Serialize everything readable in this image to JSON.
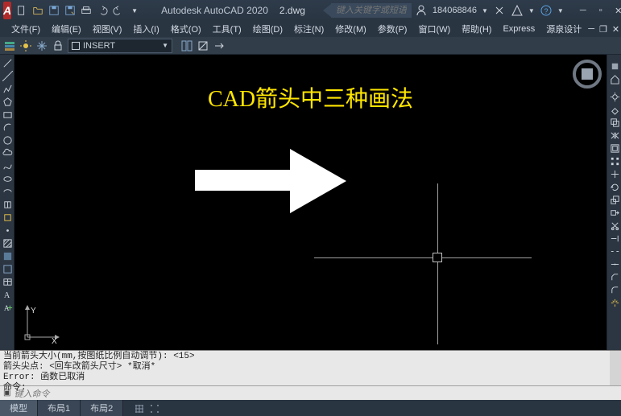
{
  "titlebar": {
    "app_name": "Autodesk AutoCAD 2020",
    "document": "2.dwg",
    "search_placeholder": "键入关键字或短语",
    "user_id": "184068846",
    "logo_letter": "A"
  },
  "menubar": {
    "items": [
      "文件(F)",
      "编辑(E)",
      "视图(V)",
      "插入(I)",
      "格式(O)",
      "工具(T)",
      "绘图(D)",
      "标注(N)",
      "修改(M)",
      "参数(P)",
      "窗口(W)",
      "帮助(H)",
      "Express",
      "源泉设计"
    ]
  },
  "layer_panel": {
    "current_layer": "INSERT"
  },
  "canvas": {
    "heading": "CAD箭头中三种画法",
    "ucs": {
      "x_label": "X",
      "y_label": "Y"
    }
  },
  "command_history": {
    "lines": [
      "当前箭头大小(mm,按图纸比例自动调节): <15>",
      "箭头尖点: <回车改箭头尺寸> *取消*",
      "Error: 函数已取消",
      "命令:"
    ]
  },
  "command_input": {
    "placeholder": "键入命令"
  },
  "tabs": {
    "items": [
      "模型",
      "布局1",
      "布局2"
    ],
    "active_index": 0
  },
  "icons": {
    "qat": [
      "new-icon",
      "open-icon",
      "save-icon",
      "saveas-icon",
      "plot-icon",
      "undo-icon",
      "redo-icon"
    ],
    "left_tools": [
      "line",
      "polyline",
      "circle",
      "arc",
      "rectangle",
      "ellipse",
      "ellipse-arc",
      "hatch",
      "spline",
      "construction-line",
      "point",
      "region",
      "revision-cloud",
      "multiline",
      "donut",
      "text",
      "mtext"
    ],
    "right_tools": [
      "cube",
      "home",
      "wheel",
      "gear",
      "move",
      "rotate",
      "trim",
      "extend",
      "mirror",
      "fillet",
      "chamfer",
      "array",
      "erase",
      "copy",
      "stretch",
      "scale",
      "offset",
      "explode"
    ]
  },
  "colors": {
    "accent_yellow": "#ffe600",
    "panel": "#2a3542",
    "canvas_bg": "#000000"
  }
}
